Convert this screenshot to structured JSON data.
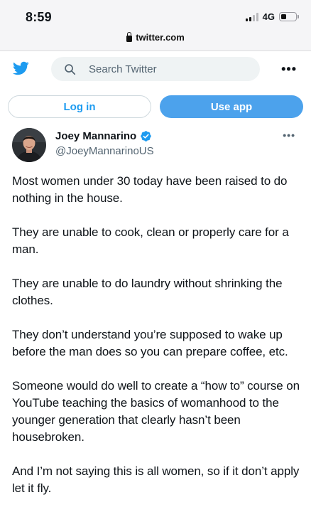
{
  "status_bar": {
    "time": "8:59",
    "network": "4G",
    "battery_level": 0.35
  },
  "browser": {
    "url": "twitter.com",
    "lock_icon": "lock-icon"
  },
  "header": {
    "logo_icon": "twitter-bird-icon",
    "search_placeholder": "Search Twitter",
    "more_icon": "more-dots-icon",
    "more_label": "•••"
  },
  "actions": {
    "login_label": "Log in",
    "use_app_label": "Use app"
  },
  "tweet": {
    "author_name": "Joey Mannarino",
    "handle": "@JoeyMannarinoUS",
    "verified": true,
    "more_label": "•••",
    "paragraphs": [
      "Most women under 30 today have been raised to do nothing in the house.",
      "They are unable to cook, clean or properly care for a man.",
      "They are unable to do laundry without shrinking the clothes.",
      "They don’t understand you’re supposed to wake up before the man does so you can prepare coffee, etc.",
      "Someone would do well to create a “how to” course on YouTube teaching the basics of womanhood to the younger generation that clearly hasn’t been housebroken.",
      "And I’m not saying this is all women, so if it don’t apply let it fly."
    ]
  },
  "colors": {
    "brand": "#1d9bf0",
    "use_app_bg": "#4ca2ec",
    "secondary_text": "#536471"
  }
}
